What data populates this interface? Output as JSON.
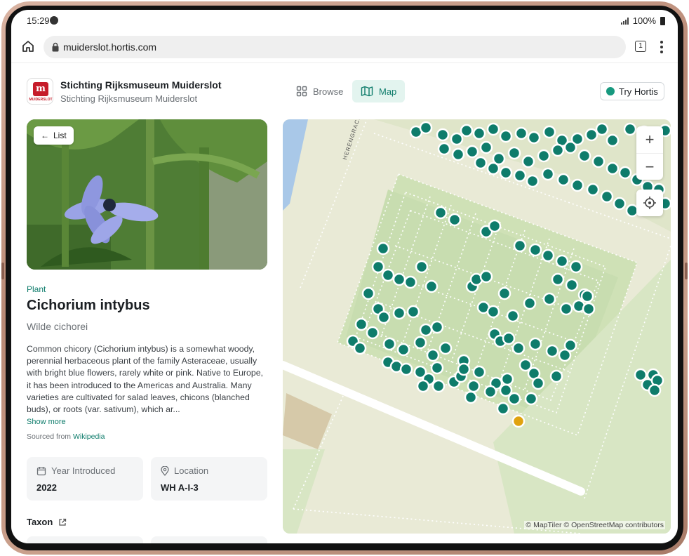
{
  "status_bar": {
    "time": "15:29",
    "battery": "100%"
  },
  "browser": {
    "url": "muiderslot.hortis.com",
    "tab_count": "1"
  },
  "header": {
    "org_name": "Stichting Rijksmuseum Muiderslot",
    "org_subtitle": "Stichting Rijksmuseum Muiderslot",
    "logo_text": "MUIDERSLOT",
    "nav": {
      "browse": "Browse",
      "map": "Map"
    },
    "try_button": "Try Hortis"
  },
  "plant": {
    "back_label": "List",
    "kind": "Plant",
    "scientific_name": "Cichorium intybus",
    "common_name": "Wilde cichorei",
    "description": "Common chicory (Cichorium intybus) is a somewhat woody, perennial herbaceous plant of the family Asteraceae, usually with bright blue flowers, rarely white or pink. Native to Europe, it has been introduced to the Americas and Australia. Many varieties are cultivated for salad leaves, chicons (blanched buds), or roots (var. sativum), which ar...",
    "show_more": "Show more",
    "source_prefix": "Sourced from",
    "source_link": "Wikipedia",
    "year_label": "Year Introduced",
    "year_value": "2022",
    "location_label": "Location",
    "location_value": "WH A-I-3",
    "taxon_label": "Taxon"
  },
  "map": {
    "street_label": "HERENGRACHT",
    "zoom_in": "+",
    "zoom_out": "−",
    "attribution": "© MapTiler © OpenStreetMap contributors",
    "colors": {
      "marker": "#0e7c6b",
      "selected_marker": "#e0a20f",
      "grass": "#d8e6c4",
      "path": "#e9ead6"
    }
  }
}
